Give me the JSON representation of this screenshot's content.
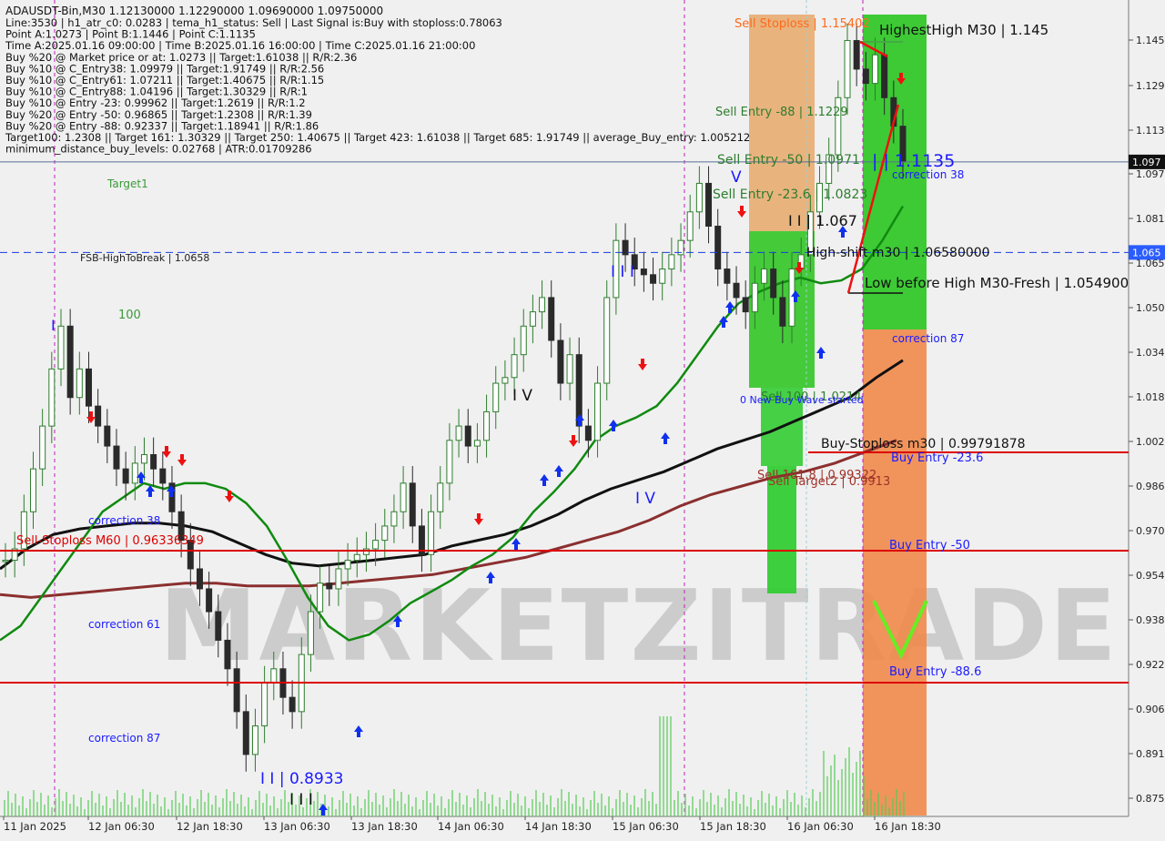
{
  "chart_data": {
    "type": "candlestick",
    "symbol": "ADAUSDT-Bin",
    "timeframe": "M30",
    "ohlc_header": "ADAUSDT-Bin,M30  1.12130000 1.12290000 1.09690000 1.09750000",
    "info_lines": [
      "Line:3530 | h1_atr_c0: 0.0283 | tema_h1_status: Sell | Last Signal is:Buy with stoploss:0.78063",
      "Point A:1.0273 | Point B:1.1446 | Point C:1.1135",
      "Time A:2025.01.16 09:00:00 | Time B:2025.01.16 16:00:00 | Time C:2025.01.16 21:00:00",
      "Buy %20 @ Market price or at: 1.0273 || Target:1.61038 || R/R:2.36",
      "Buy %10 @ C_Entry38: 1.09979 || Target:1.91749 || R/R:2.56",
      "Buy %10 @ C_Entry61: 1.07211 || Target:1.40675 || R/R:1.15",
      "Buy %10 @ C_Entry88: 1.04196 || Target:1.30329 || R/R:1",
      "Buy %10 @ Entry -23: 0.99962 || Target:1.2619 || R/R:1.2",
      "Buy %20 @ Entry -50: 0.96865 || Target:1.2308 || R/R:1.39",
      "Buy %20 @ Entry -88: 0.92337 || Target:1.18941 || R/R:1.86",
      "Target100: 1.2308 || Target 161: 1.30329 || Target 250: 1.40675 || Target 423: 1.61038 || Target 685: 1.91749 || average_Buy_entry: 1.005212",
      "minimum_distance_buy_levels: 0.02768 | ATR:0.01709286"
    ],
    "y_ticks": [
      "1.145",
      "1.129",
      "1.113",
      "1.097",
      "1.081",
      "1.065",
      "1.050",
      "1.034",
      "1.018",
      "1.002",
      "0.986",
      "0.970",
      "0.954",
      "0.938",
      "0.922",
      "0.906",
      "0.891",
      "0.875"
    ],
    "ylim": [
      0.8683,
      1.1542
    ],
    "x_ticks": [
      "11 Jan 2025",
      "12 Jan 06:30",
      "12 Jan 18:30",
      "13 Jan 06:30",
      "13 Jan 18:30",
      "14 Jan 06:30",
      "14 Jan 18:30",
      "15 Jan 06:30",
      "15 Jan 18:30",
      "16 Jan 06:30",
      "16 Jan 18:30"
    ],
    "current_price": 1.0975,
    "current_price_label": "1.097",
    "fsb_price": 1.0658,
    "fsb_price_label": "1.065",
    "close_series": [
      0.958,
      0.962,
      0.975,
      0.99,
      1.005,
      1.025,
      1.04,
      1.015,
      1.025,
      1.012,
      1.005,
      0.998,
      0.99,
      0.985,
      0.992,
      0.995,
      0.99,
      0.985,
      0.975,
      0.965,
      0.955,
      0.948,
      0.94,
      0.93,
      0.92,
      0.905,
      0.89,
      0.9,
      0.915,
      0.92,
      0.91,
      0.905,
      0.925,
      0.94,
      0.95,
      0.948,
      0.955,
      0.958,
      0.96,
      0.962,
      0.965,
      0.97,
      0.975,
      0.985,
      0.97,
      0.96,
      0.975,
      0.985,
      1.0,
      1.005,
      0.998,
      1.0,
      1.01,
      1.02,
      1.022,
      1.03,
      1.04,
      1.045,
      1.05,
      1.035,
      1.02,
      1.03,
      1.005,
      1.0,
      1.02,
      1.05,
      1.07,
      1.065,
      1.06,
      1.058,
      1.055,
      1.06,
      1.065,
      1.07,
      1.08,
      1.09,
      1.075,
      1.06,
      1.055,
      1.05,
      1.045,
      1.055,
      1.06,
      1.05,
      1.04,
      1.06,
      1.065,
      1.08,
      1.09,
      1.1,
      1.12,
      1.14,
      1.13,
      1.125,
      1.135,
      1.12,
      1.11,
      1.0975
    ],
    "ma_green": [
      0.93,
      0.935,
      0.945,
      0.955,
      0.965,
      0.975,
      0.98,
      0.985,
      0.983,
      0.985,
      0.985,
      0.983,
      0.978,
      0.97,
      0.958,
      0.945,
      0.935,
      0.93,
      0.932,
      0.937,
      0.943,
      0.947,
      0.951,
      0.956,
      0.96,
      0.966,
      0.975,
      0.982,
      0.99,
      1.0,
      1.005,
      1.008,
      1.012,
      1.02,
      1.03,
      1.04,
      1.048,
      1.052,
      1.055,
      1.057,
      1.055,
      1.056,
      1.06,
      1.07,
      1.082
    ],
    "ma_black": [
      0.955,
      0.962,
      0.967,
      0.969,
      0.97,
      0.971,
      0.971,
      0.97,
      0.968,
      0.964,
      0.96,
      0.957,
      0.956,
      0.957,
      0.958,
      0.959,
      0.96,
      0.963,
      0.965,
      0.967,
      0.97,
      0.974,
      0.979,
      0.983,
      0.986,
      0.989,
      0.993,
      0.997,
      1.0,
      1.003,
      1.007,
      1.011,
      1.015,
      1.022,
      1.028
    ],
    "ma_brown": [
      0.946,
      0.945,
      0.946,
      0.947,
      0.948,
      0.949,
      0.95,
      0.95,
      0.949,
      0.949,
      0.949,
      0.95,
      0.951,
      0.952,
      0.953,
      0.955,
      0.957,
      0.959,
      0.962,
      0.965,
      0.968,
      0.972,
      0.977,
      0.981,
      0.984,
      0.987,
      0.989,
      0.992,
      0.996,
      1.0
    ],
    "horizontal_levels": [
      {
        "label": "Sell-Stoploss M60 | 0.96336349",
        "price": 0.96336,
        "color": "#dd0000"
      },
      {
        "label": "Buy Entry -50",
        "price": 0.96336,
        "color": "#1a1aff"
      },
      {
        "label": "Buy Entry -88.6",
        "price": 0.9155,
        "color": "#1a1aff"
      },
      {
        "label": "Buy Entry -23.6",
        "price": 0.9979,
        "color": "#1a1aff"
      },
      {
        "label": "Buy-Stoploss m30 | 0.99791878",
        "price": 0.9979,
        "color": "#111111"
      }
    ],
    "annotations": [
      {
        "text": "Target1",
        "color": "#3a9a3a"
      },
      {
        "text": "FSB-HighToBreak | 1.0658",
        "color": "#222222"
      },
      {
        "text": "100",
        "color": "#3a9a3a"
      },
      {
        "text": "I",
        "color": "#1a1aff"
      },
      {
        "text": "correction 38",
        "color": "#1a1aff"
      },
      {
        "text": "correction 61",
        "color": "#1a1aff"
      },
      {
        "text": "correction 87",
        "color": "#1a1aff"
      },
      {
        "text": "I I | 0.8933",
        "color": "#1a1aff"
      },
      {
        "text": "I I I",
        "color": "#111111"
      },
      {
        "text": "I V",
        "color": "#111111"
      },
      {
        "text": "I I I",
        "color": "#1a1aff"
      },
      {
        "text": "I V",
        "color": "#1a1aff"
      },
      {
        "text": "V",
        "color": "#1a1aff"
      },
      {
        "text": "Sell Stoploss | 1.15402",
        "color": "#ff6a1a"
      },
      {
        "text": "Sell Entry -88 | 1.1229",
        "color": "#2e7d2e"
      },
      {
        "text": "Sell Entry -50 | 1.0971",
        "color": "#2e7d2e"
      },
      {
        "text": "Sell Entry -23.6 | 1.0823",
        "color": "#2e7d2e"
      },
      {
        "text": "HighestHigh   M30 | 1.145",
        "color": "#111111"
      },
      {
        "text": "| | 1.1135",
        "color": "#1a1aff"
      },
      {
        "text": "correction 38",
        "color": "#1a1aff"
      },
      {
        "text": "I I | 1.067",
        "color": "#111111"
      },
      {
        "text": "High-shift m30 | 1.06580000",
        "color": "#111111"
      },
      {
        "text": "Low before High   M30-Fresh | 1.054900",
        "color": "#111111"
      },
      {
        "text": "correction 87",
        "color": "#1a1aff"
      },
      {
        "text": "Sell 100 | 1.0214",
        "color": "#2e7d2e"
      },
      {
        "text": "0 New Buy Wave started",
        "color": "#1a1aff"
      },
      {
        "text": "Sell 161.8 | 0.99322",
        "color": "#a0322a"
      },
      {
        "text": "Sell Target2 | 0.9913",
        "color": "#a0322a"
      }
    ],
    "watermark": "MARKETZITRADE",
    "colors": {
      "background": "#f0f0f0",
      "bull": "#2e7d2e",
      "bear": "#2a2a2a",
      "ma_green": "#108a10",
      "ma_black": "#111111",
      "ma_brown": "#8b2f2f",
      "level_red": "#dd0000",
      "fsb_blue": "#1a3cdd",
      "zone_green": "#33cc33",
      "zone_orange": "#f08a4b",
      "zone_tan": "#e8a86a"
    }
  }
}
